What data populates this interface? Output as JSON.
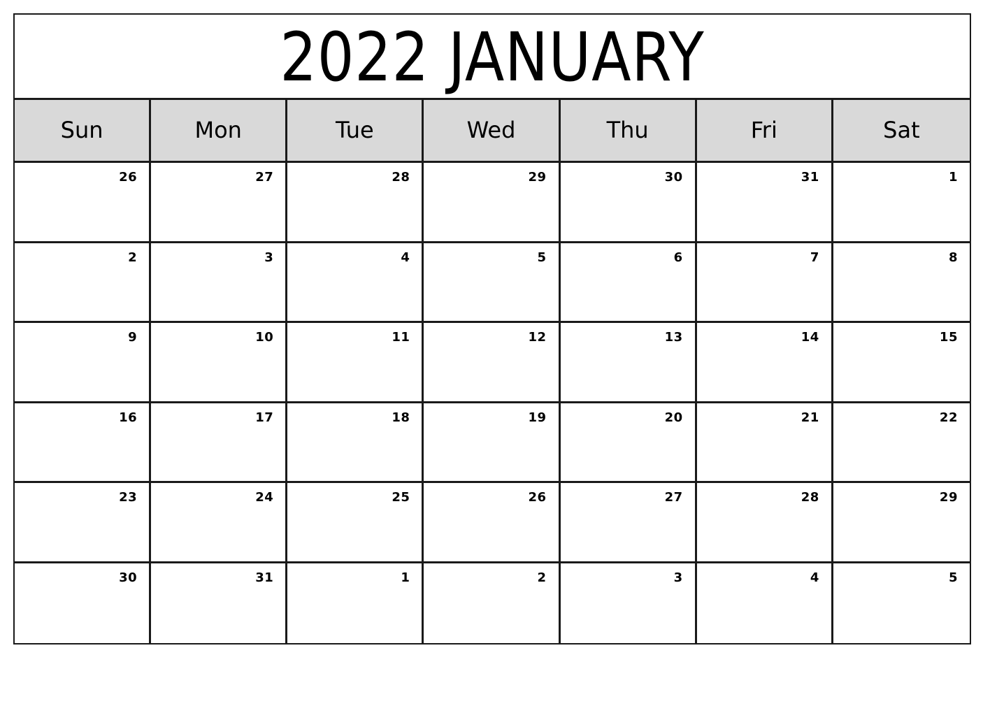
{
  "calendar": {
    "title": "2022 JANUARY",
    "weekdays": [
      "Sun",
      "Mon",
      "Tue",
      "Wed",
      "Thu",
      "Fri",
      "Sat"
    ],
    "weeks": [
      [
        "26",
        "27",
        "28",
        "29",
        "30",
        "31",
        "1"
      ],
      [
        "2",
        "3",
        "4",
        "5",
        "6",
        "7",
        "8"
      ],
      [
        "9",
        "10",
        "11",
        "12",
        "13",
        "14",
        "15"
      ],
      [
        "16",
        "17",
        "18",
        "19",
        "20",
        "21",
        "22"
      ],
      [
        "23",
        "24",
        "25",
        "26",
        "27",
        "28",
        "29"
      ],
      [
        "30",
        "31",
        "1",
        "2",
        "3",
        "4",
        "5"
      ]
    ],
    "colors": {
      "header_background": "#d9d9d9",
      "border": "#1a1a1a"
    }
  }
}
